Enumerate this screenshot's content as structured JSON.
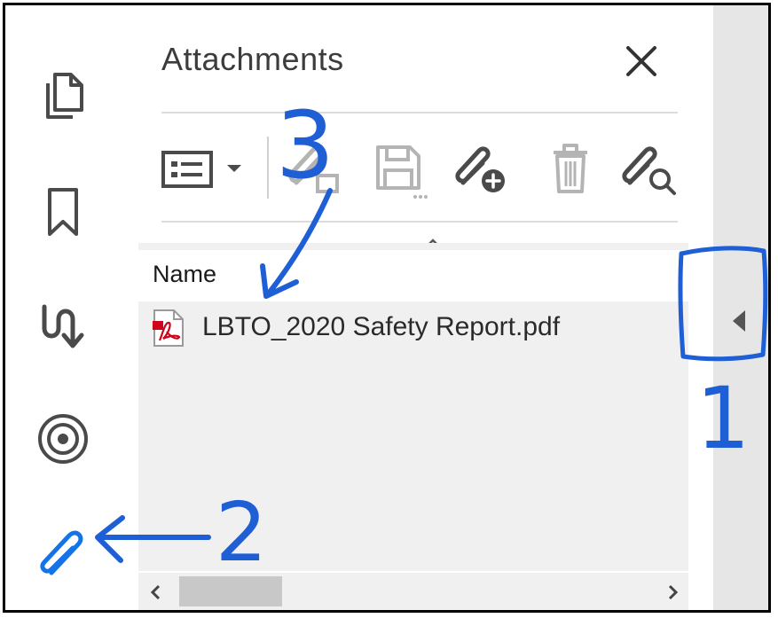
{
  "panel": {
    "title": "Attachments",
    "column_header": "Name",
    "files": [
      {
        "name": "LBTO_2020 Safety Report.pdf",
        "icon": "pdf-file-icon"
      }
    ]
  },
  "left_toolbar": {
    "icons": [
      "pages-icon",
      "bookmark-icon",
      "destinations-icon",
      "layers-icon",
      "attachment-icon"
    ]
  },
  "panel_toolbar": {
    "icons": [
      "options-menu-icon",
      "open-attachment-icon",
      "save-attachment-icon",
      "add-attachment-icon",
      "delete-attachment-icon",
      "search-attachment-icon"
    ]
  },
  "annotations": {
    "label_1": "1",
    "label_2": "2",
    "label_3": "3"
  },
  "colors": {
    "annotation_blue": "#1f5fd6",
    "active_icon_blue": "#1473e6",
    "pdf_red": "#d0021b",
    "icon_gray": "#4a4a4a",
    "disabled_gray": "#b4b4b4"
  }
}
